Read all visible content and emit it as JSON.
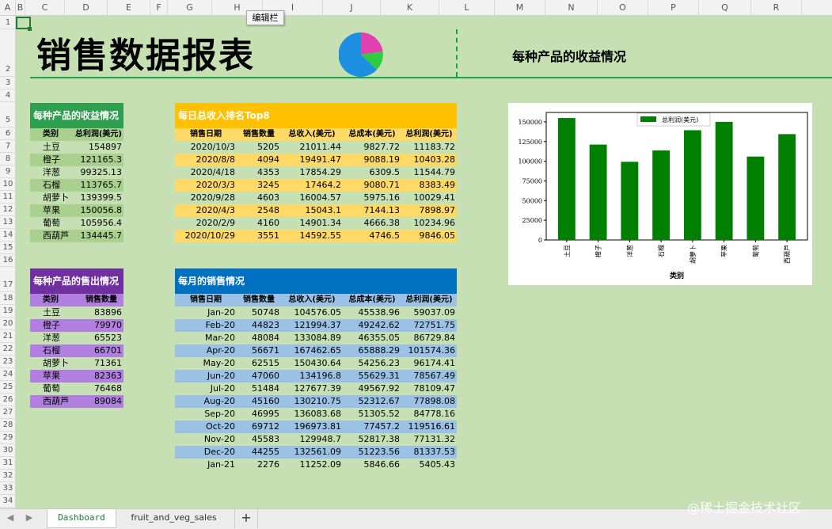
{
  "spreadsheet": {
    "columns": [
      "A",
      "B",
      "C",
      "D",
      "E",
      "F",
      "G",
      "H",
      "I",
      "J",
      "K",
      "L",
      "M",
      "N",
      "O",
      "P",
      "Q",
      "R"
    ],
    "rows": [
      "1",
      "2",
      "3",
      "4",
      "5",
      "6",
      "7",
      "8",
      "9",
      "10",
      "11",
      "12",
      "13",
      "14",
      "15",
      "16",
      "17",
      "18",
      "19",
      "20",
      "21",
      "22",
      "23",
      "24",
      "25",
      "26",
      "27",
      "28",
      "29",
      "30",
      "31",
      "32",
      "33",
      "34"
    ],
    "tooltip": "编辑栏"
  },
  "dashboard": {
    "title": "销售数据报表",
    "subtitle": "每种产品的收益情况"
  },
  "revenue_table": {
    "caption": "每种产品的收益情况",
    "headers": [
      "类别",
      "总利润(美元)"
    ],
    "rows": [
      [
        "土豆",
        "154897"
      ],
      [
        "橙子",
        "121165.3"
      ],
      [
        "洋葱",
        "99325.13"
      ],
      [
        "石榴",
        "113765.7"
      ],
      [
        "胡萝卜",
        "139399.5"
      ],
      [
        "苹果",
        "150056.8"
      ],
      [
        "葡萄",
        "105956.4"
      ],
      [
        "西葫芦",
        "134445.7"
      ]
    ]
  },
  "sales_qty_table": {
    "caption": "每种产品的售出情况",
    "headers": [
      "类别",
      "销售数量"
    ],
    "rows": [
      [
        "土豆",
        "83896"
      ],
      [
        "橙子",
        "79970"
      ],
      [
        "洋葱",
        "65523"
      ],
      [
        "石榴",
        "66701"
      ],
      [
        "胡萝卜",
        "71361"
      ],
      [
        "苹果",
        "82363"
      ],
      [
        "葡萄",
        "76468"
      ],
      [
        "西葫芦",
        "89084"
      ]
    ]
  },
  "top8_table": {
    "caption": "每日总收入排名Top8",
    "headers": [
      "销售日期",
      "销售数量",
      "总收入(美元)",
      "总成本(美元)",
      "总利润(美元)"
    ],
    "rows": [
      [
        "2020/10/3",
        "5205",
        "21011.44",
        "9827.72",
        "11183.72"
      ],
      [
        "2020/8/8",
        "4094",
        "19491.47",
        "9088.19",
        "10403.28"
      ],
      [
        "2020/4/18",
        "4353",
        "17854.29",
        "6309.5",
        "11544.79"
      ],
      [
        "2020/3/3",
        "3245",
        "17464.2",
        "9080.71",
        "8383.49"
      ],
      [
        "2020/9/28",
        "4603",
        "16004.57",
        "5975.16",
        "10029.41"
      ],
      [
        "2020/4/3",
        "2548",
        "15043.1",
        "7144.13",
        "7898.97"
      ],
      [
        "2020/2/9",
        "4160",
        "14901.34",
        "4666.38",
        "10234.96"
      ],
      [
        "2020/10/29",
        "3551",
        "14592.55",
        "4746.5",
        "9846.05"
      ]
    ]
  },
  "monthly_table": {
    "caption": "每月的销售情况",
    "headers": [
      "销售日期",
      "销售数量",
      "总收入(美元)",
      "总成本(美元)",
      "总利润(美元)"
    ],
    "rows": [
      [
        "Jan-20",
        "50748",
        "104576.05",
        "45538.96",
        "59037.09"
      ],
      [
        "Feb-20",
        "44823",
        "121994.37",
        "49242.62",
        "72751.75"
      ],
      [
        "Mar-20",
        "48084",
        "133084.89",
        "46355.05",
        "86729.84"
      ],
      [
        "Apr-20",
        "56671",
        "167462.65",
        "65888.29",
        "101574.36"
      ],
      [
        "May-20",
        "62515",
        "150430.64",
        "54256.23",
        "96174.41"
      ],
      [
        "Jun-20",
        "47060",
        "134196.8",
        "55629.31",
        "78567.49"
      ],
      [
        "Jul-20",
        "51484",
        "127677.39",
        "49567.92",
        "78109.47"
      ],
      [
        "Aug-20",
        "45160",
        "130210.75",
        "52312.67",
        "77898.08"
      ],
      [
        "Sep-20",
        "46995",
        "136083.68",
        "51305.52",
        "84778.16"
      ],
      [
        "Oct-20",
        "69712",
        "196973.81",
        "77457.2",
        "119516.61"
      ],
      [
        "Nov-20",
        "45583",
        "129948.7",
        "52817.38",
        "77131.32"
      ],
      [
        "Dec-20",
        "44255",
        "132561.09",
        "51223.56",
        "81337.53"
      ],
      [
        "Jan-21",
        "2276",
        "11252.09",
        "5846.66",
        "5405.43"
      ]
    ]
  },
  "chart_data": {
    "type": "bar",
    "categories": [
      "土豆",
      "橙子",
      "洋葱",
      "石榴",
      "胡萝卜",
      "苹果",
      "葡萄",
      "西葫芦"
    ],
    "series": [
      {
        "name": "总利润(美元)",
        "values": [
          154897,
          121165.3,
          99325.13,
          113765.7,
          139399.5,
          150056.8,
          105956.4,
          134445.7
        ]
      }
    ],
    "xlabel": "类别",
    "ylabel": "",
    "yticks": [
      "0",
      "25000",
      "50000",
      "75000",
      "100000",
      "125000",
      "150000"
    ],
    "ylim": [
      0,
      162000
    ],
    "legend": "top-center",
    "grid": false,
    "color": "#008000"
  },
  "sheet_tabs": {
    "active": "Dashboard",
    "other": "fruit_and_veg_sales",
    "add": "+",
    "prev": "◀",
    "next": "▶"
  },
  "watermark": "@稀土掘金技术社区",
  "colors": {
    "green_header": "#2e9e4f",
    "green_row": "#a9d08e",
    "orange_header": "#ffc000",
    "orange_row": "#ffd966",
    "purple_header": "#7030a0",
    "purple_row": "#b07fe0",
    "blue_header": "#0070c0",
    "blue_row": "#9bc2e6"
  }
}
